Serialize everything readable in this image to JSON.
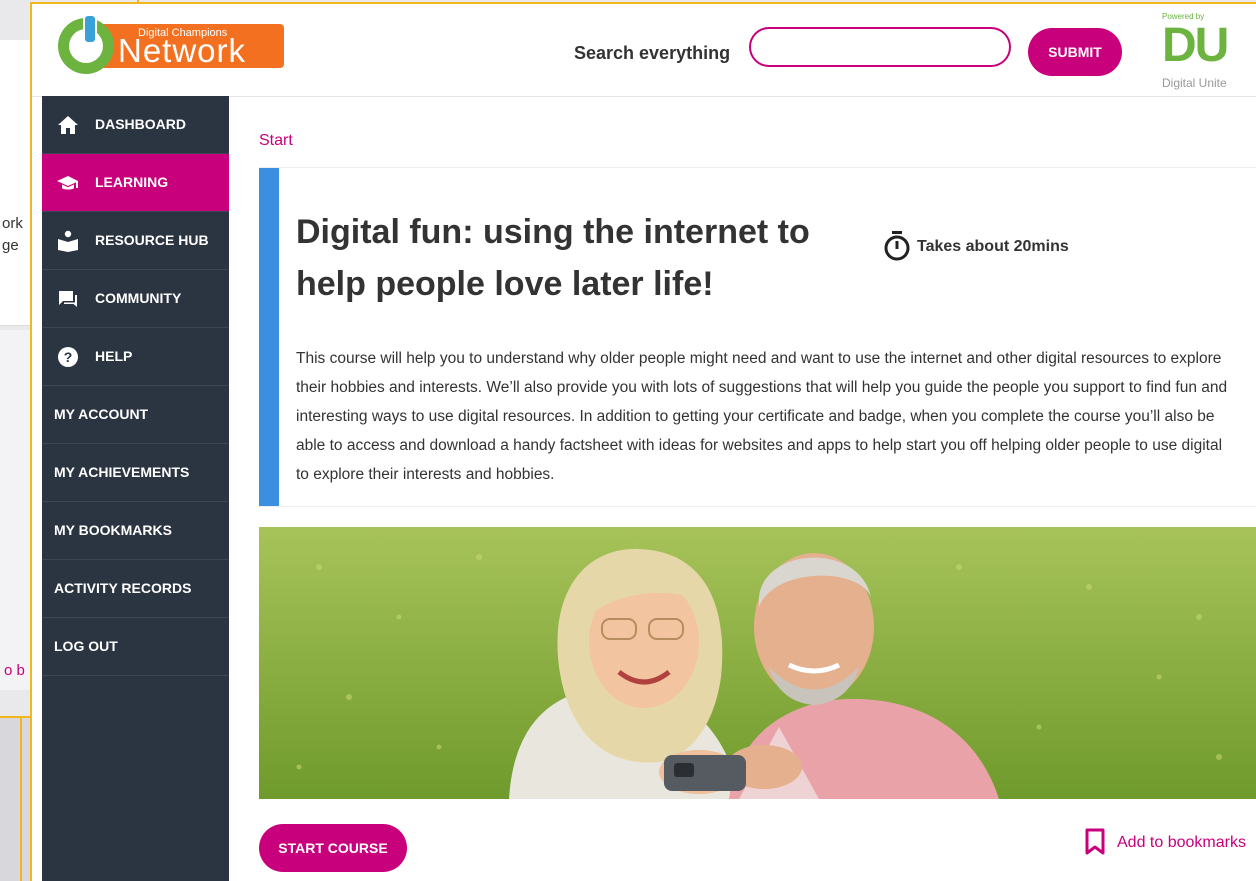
{
  "background": {
    "snippet_line1": "ork",
    "snippet_line2": "ge",
    "snippet_link": "o b"
  },
  "header": {
    "logo": {
      "small": "Digital Champions",
      "big": "Network"
    },
    "search_label": "Search everything",
    "search_value": "",
    "search_placeholder": "",
    "submit_label": "SUBMIT",
    "partner_logo": {
      "powered": "Powered by",
      "letters": "DU",
      "name": "Digital Unite"
    }
  },
  "sidebar": {
    "items": [
      {
        "label": "DASHBOARD",
        "icon": "home-icon",
        "active": false
      },
      {
        "label": "LEARNING",
        "icon": "graduation-cap-icon",
        "active": true
      },
      {
        "label": "RESOURCE HUB",
        "icon": "book-reader-icon",
        "active": false
      },
      {
        "label": "COMMUNITY",
        "icon": "chat-icon",
        "active": false
      },
      {
        "label": "HELP",
        "icon": "question-icon",
        "active": false
      },
      {
        "label": "MY ACCOUNT",
        "icon": "",
        "active": false
      },
      {
        "label": "MY ACHIEVEMENTS",
        "icon": "",
        "active": false
      },
      {
        "label": "MY BOOKMARKS",
        "icon": "",
        "active": false
      },
      {
        "label": "ACTIVITY RECORDS",
        "icon": "",
        "active": false
      },
      {
        "label": "LOG OUT",
        "icon": "",
        "active": false
      }
    ]
  },
  "main": {
    "breadcrumb": "Start",
    "title": "Digital fun: using the internet to help people love later life!",
    "duration": "Takes about 20mins",
    "description": "This course will help you to understand why older people might need and want to use the internet and other digital resources to explore their hobbies and interests. We’ll also provide you with lots of suggestions that will help you guide the people you support to find fun and interesting ways to use digital resources.  In addition to getting your certificate and badge, when you complete the course you’ll also be able to access and download a handy factsheet with ideas for websites and apps to help start you off helping older people to use digital to explore their interests and hobbies.",
    "start_label": "START COURSE",
    "bookmark_label": "Add to bookmarks"
  },
  "colors": {
    "brand_magenta": "#c8007c",
    "sidebar_bg": "#2b3441",
    "accent_blue": "#3b8ee0",
    "frame_yellow": "#f1b71c",
    "logo_orange": "#f37021",
    "logo_green": "#6cb33f"
  }
}
